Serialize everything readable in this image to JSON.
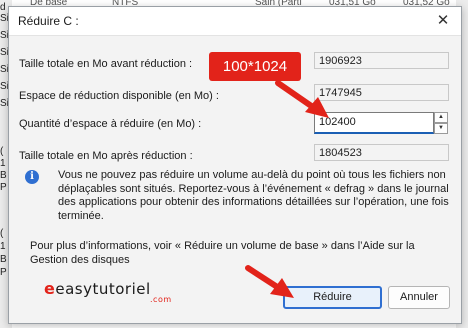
{
  "background": {
    "left_fragments": [
      "d",
      "Si",
      "Si",
      "Si",
      "Si",
      "Si",
      "Si",
      "(",
      "1",
      "B",
      "P",
      "(",
      "1",
      "B",
      "P"
    ],
    "top_fragments": [
      "De base",
      "NTFS",
      "Sain (Parti",
      "031,51 Go",
      "031,52 Go"
    ]
  },
  "dialog": {
    "title": "Réduire C :",
    "rows": [
      {
        "label": "Taille totale en Mo avant réduction :",
        "value": "1906923"
      },
      {
        "label": "Espace de réduction disponible (en Mo) :",
        "value": "1747945"
      },
      {
        "label": "Quantité d’espace à réduire (en Mo) :",
        "value": "102400"
      },
      {
        "label": "Taille totale en Mo après réduction :",
        "value": "1804523"
      }
    ],
    "info_text": "Vous ne pouvez pas réduire un volume au-delà du point où tous les fichiers non déplaçables sont situés. Reportez-vous à l’événement « defrag » dans le journal des applications pour obtenir des informations détaillées sur l’opération, une fois terminée.",
    "more_info_text": "Pour plus d’informations, voir « Réduire un volume de base » dans l’Aide sur la Gestion des disques",
    "buttons": {
      "shrink": "Réduire",
      "cancel": "Annuler"
    }
  },
  "annotation": {
    "callout_text": "100*1024",
    "accent_color": "#e2231a"
  },
  "watermark": {
    "brand": "easytutoriel",
    "suffix": ".com"
  },
  "icons": {
    "close": "close-icon",
    "info": "info-icon",
    "spin_up": "chevron-up-icon",
    "spin_down": "chevron-down-icon"
  }
}
